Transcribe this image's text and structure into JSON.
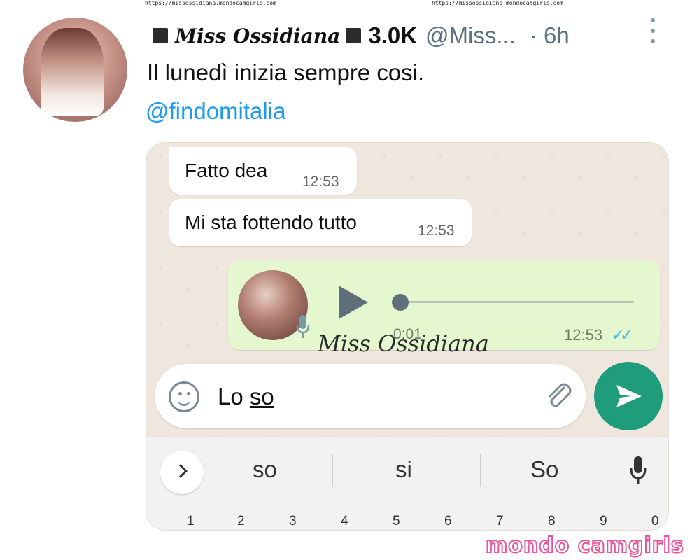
{
  "watermark": {
    "url_left": "https://missossidiana.mondocamgirls.com",
    "url_right": "https://missossidiana.mondocamgirls.com",
    "overlay": "Miss Ossidiana",
    "brand": "mondo camgirls"
  },
  "tweet": {
    "display_name": "Miss Ossidiana",
    "followers": "3.0K",
    "handle": "@Miss...",
    "time": "· 6h",
    "text": "Il lunedì inizia sempre cosi.",
    "mention": "@findomitalia"
  },
  "chat": {
    "incoming": [
      {
        "text": "Fatto dea",
        "time": "12:53"
      },
      {
        "text": "Mi sta fottendo tutto",
        "time": "12:53"
      }
    ],
    "voice": {
      "duration": "0:01",
      "time": "12:53",
      "read_ticks": "✓✓",
      "progress": 0
    },
    "input": {
      "before": "Lo ",
      "underlined": "so"
    }
  },
  "keyboard": {
    "suggestions": [
      "so",
      "si",
      "So"
    ],
    "numbers": [
      "1",
      "2",
      "3",
      "4",
      "5",
      "6",
      "7",
      "8",
      "9",
      "0"
    ]
  },
  "colors": {
    "link": "#1d9bf0",
    "outgoing_bubble": "#e4f7cf",
    "send_button": "#1f9c7c",
    "brand_pink": "#e8569c"
  }
}
